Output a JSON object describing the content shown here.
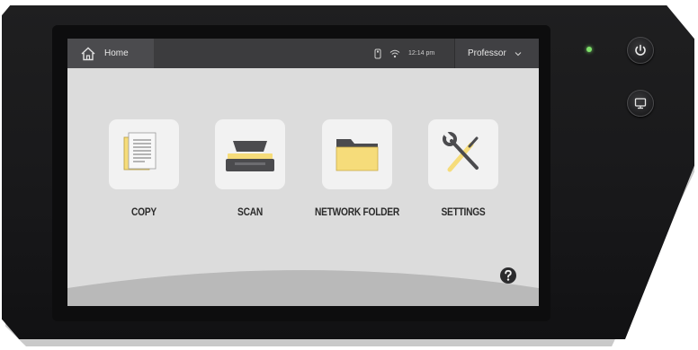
{
  "header": {
    "home_label": "Home",
    "time": "12:14 pm",
    "user": "Professor"
  },
  "apps": [
    {
      "label": "COPY",
      "icon": "copy-document-icon"
    },
    {
      "label": "SCAN",
      "icon": "scanner-icon"
    },
    {
      "label": "NETWORK FOLDER",
      "icon": "folder-icon"
    },
    {
      "label": "SETTINGS",
      "icon": "wrench-screwdriver-icon"
    }
  ],
  "hardware": {
    "power_icon": "power-icon",
    "display_icon": "display-icon",
    "led_color": "#7fe26a"
  },
  "colors": {
    "accent_yellow": "#f6dc7a",
    "topbar": "#3c3c3e",
    "screen_bg": "#dcdcdc"
  }
}
